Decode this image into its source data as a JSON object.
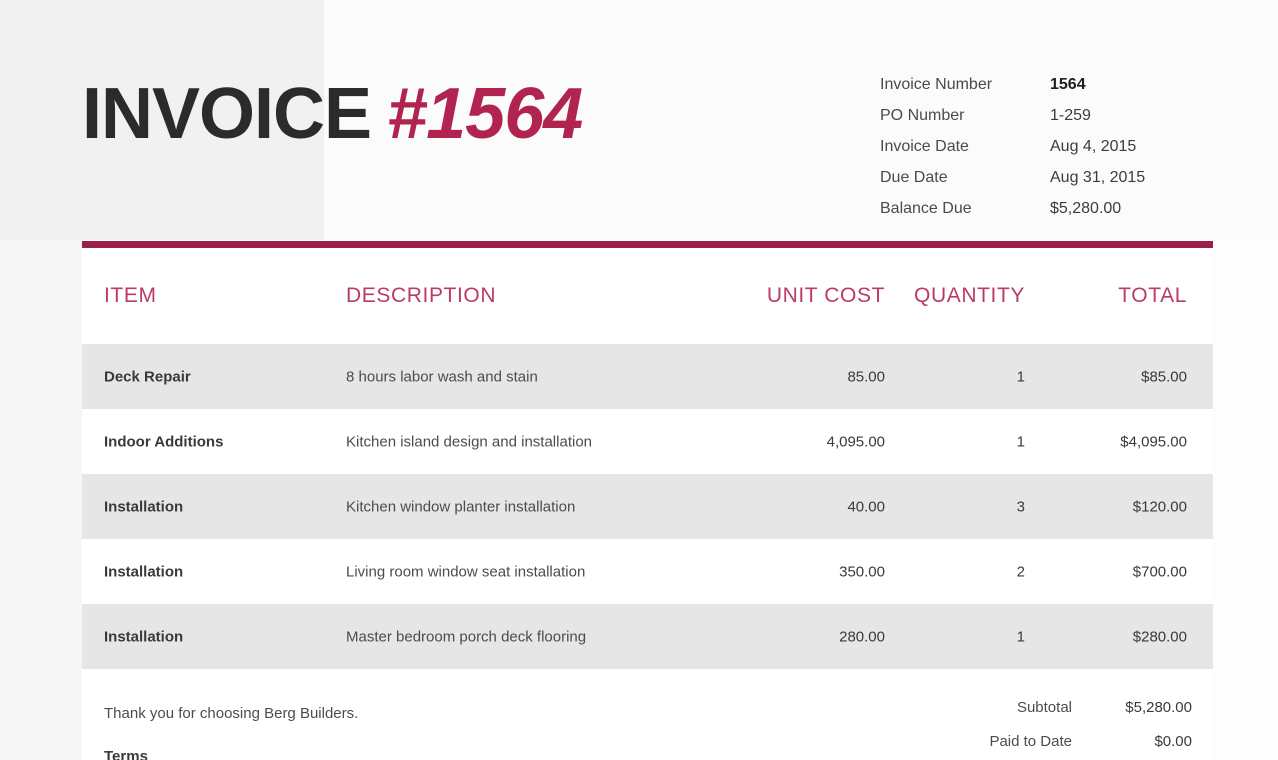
{
  "document": {
    "title_word": "INVOICE",
    "title_number": "#1564"
  },
  "meta": {
    "rows": [
      {
        "label": "Invoice Number",
        "value": "1564",
        "bold": true
      },
      {
        "label": "PO Number",
        "value": "1-259",
        "bold": false
      },
      {
        "label": "Invoice Date",
        "value": "Aug 4, 2015",
        "bold": false
      },
      {
        "label": "Due Date",
        "value": "Aug 31, 2015",
        "bold": false
      },
      {
        "label": "Balance Due",
        "value": "$5,280.00",
        "bold": false
      }
    ]
  },
  "table": {
    "headers": {
      "item": "ITEM",
      "description": "DESCRIPTION",
      "unit_cost": "UNIT COST",
      "quantity": "QUANTITY",
      "total": "TOTAL"
    },
    "rows": [
      {
        "item": "Deck Repair",
        "description": "8 hours labor wash and stain",
        "unit_cost": "85.00",
        "quantity": "1",
        "total": "$85.00"
      },
      {
        "item": "Indoor Additions",
        "description": "Kitchen island design and installation",
        "unit_cost": "4,095.00",
        "quantity": "1",
        "total": "$4,095.00"
      },
      {
        "item": "Installation",
        "description": "Kitchen window planter installation",
        "unit_cost": "40.00",
        "quantity": "3",
        "total": "$120.00"
      },
      {
        "item": "Installation",
        "description": "Living room window seat installation",
        "unit_cost": "350.00",
        "quantity": "2",
        "total": "$700.00"
      },
      {
        "item": "Installation",
        "description": "Master bedroom porch deck flooring",
        "unit_cost": "280.00",
        "quantity": "1",
        "total": "$280.00"
      }
    ]
  },
  "footer": {
    "thanks": "Thank you for choosing Berg Builders.",
    "terms_heading": "Terms",
    "totals": [
      {
        "label": "Subtotal",
        "value": "$5,280.00"
      },
      {
        "label": "Paid to Date",
        "value": "$0.00"
      }
    ]
  },
  "colors": {
    "accent_bar": "#9d1f47",
    "accent_text": "#bc3b66",
    "title_number": "#b0244f",
    "row_alt": "#e6e6e6",
    "panel": "#f1f1f2"
  }
}
